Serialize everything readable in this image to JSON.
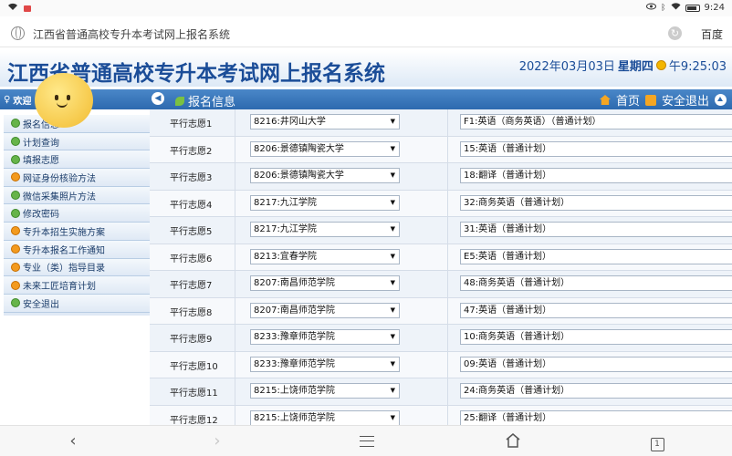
{
  "status_bar": {
    "time": "9:24"
  },
  "browser": {
    "url_text": "江西省普通高校专升本考试网上报名系统",
    "engine": "百度"
  },
  "header": {
    "title": "江西省普通高校专升本考试网上报名系统",
    "date": "2022年03月03日",
    "weekday": "星期四",
    "time": "午9:25:03"
  },
  "navbar": {
    "welcome": "欢迎",
    "breadcrumb": "报名信息",
    "home": "首页",
    "logout": "安全退出"
  },
  "sidebar": {
    "items": [
      {
        "label": "报名信息",
        "color": "green"
      },
      {
        "label": "计划查询",
        "color": "green"
      },
      {
        "label": "填报志愿",
        "color": "green"
      },
      {
        "label": "网证身份核验方法",
        "color": "orange"
      },
      {
        "label": "微信采集照片方法",
        "color": "green"
      },
      {
        "label": "修改密码",
        "color": "green"
      },
      {
        "label": "专升本招生实施方案",
        "color": "orange"
      },
      {
        "label": "专升本报名工作通知",
        "color": "orange"
      },
      {
        "label": "专业（类）指导目录",
        "color": "orange"
      },
      {
        "label": "未来工匠培育计划",
        "color": "orange"
      },
      {
        "label": "安全退出",
        "color": "green"
      }
    ]
  },
  "choices": [
    {
      "label": "平行志愿1",
      "school": "8216:井冈山大学",
      "major": "F1:英语（商务英语）（普通计划）"
    },
    {
      "label": "平行志愿2",
      "school": "8206:景德镇陶瓷大学",
      "major": "15:英语（普通计划）"
    },
    {
      "label": "平行志愿3",
      "school": "8206:景德镇陶瓷大学",
      "major": "18:翻译（普通计划）"
    },
    {
      "label": "平行志愿4",
      "school": "8217:九江学院",
      "major": "32:商务英语（普通计划）"
    },
    {
      "label": "平行志愿5",
      "school": "8217:九江学院",
      "major": "31:英语（普通计划）"
    },
    {
      "label": "平行志愿6",
      "school": "8213:宜春学院",
      "major": "E5:英语（普通计划）"
    },
    {
      "label": "平行志愿7",
      "school": "8207:南昌师范学院",
      "major": "48:商务英语（普通计划）"
    },
    {
      "label": "平行志愿8",
      "school": "8207:南昌师范学院",
      "major": "47:英语（普通计划）"
    },
    {
      "label": "平行志愿9",
      "school": "8233:豫章师范学院",
      "major": "10:商务英语（普通计划）"
    },
    {
      "label": "平行志愿10",
      "school": "8233:豫章师范学院",
      "major": "09:英语（普通计划）"
    },
    {
      "label": "平行志愿11",
      "school": "8215:上饶师范学院",
      "major": "24:商务英语（普通计划）"
    },
    {
      "label": "平行志愿12",
      "school": "8215:上饶师范学院",
      "major": "25:翻译（普通计划）"
    }
  ],
  "bottom_nav": {
    "tab_count": "1"
  },
  "colors": {
    "title_blue": "#1b4d98",
    "nav_blue": "#2d6aaf",
    "icon_orange": "#f5a623",
    "icon_green": "#66b44a"
  }
}
